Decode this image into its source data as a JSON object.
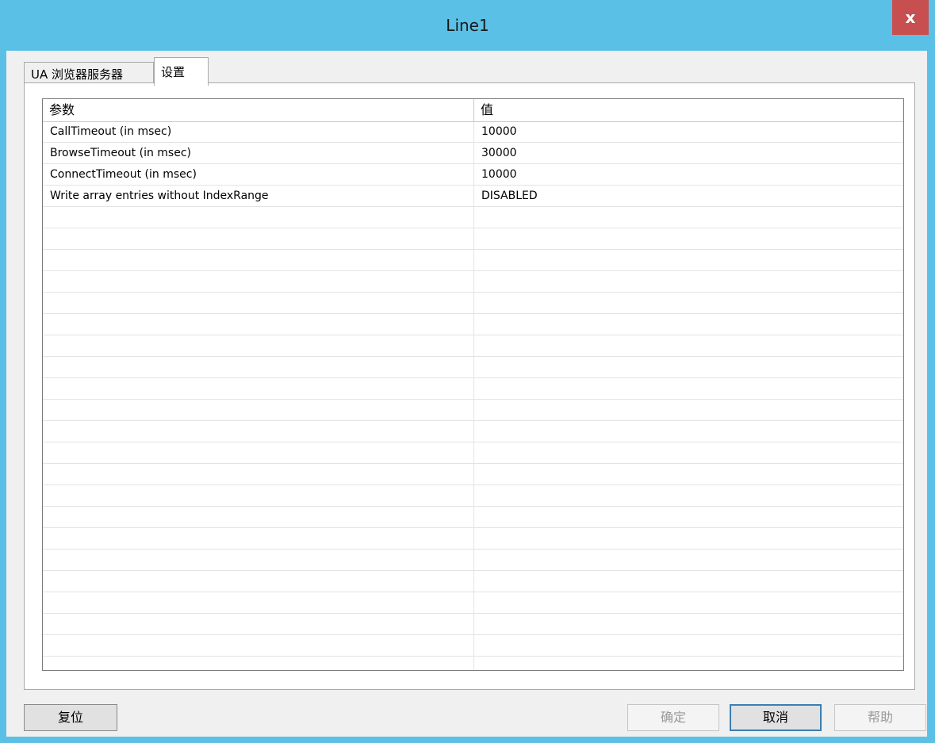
{
  "window": {
    "title": "Line1",
    "close_label": "x"
  },
  "tabs": [
    {
      "label": "UA 浏览器服务器",
      "active": false
    },
    {
      "label": "设置",
      "active": true
    }
  ],
  "grid": {
    "columns": [
      "参数",
      "值"
    ],
    "rows": [
      {
        "param": "CallTimeout (in msec)",
        "value": "10000"
      },
      {
        "param": "BrowseTimeout (in msec)",
        "value": "30000"
      },
      {
        "param": "ConnectTimeout (in msec)",
        "value": "10000"
      },
      {
        "param": "Write array entries without IndexRange",
        "value": "DISABLED"
      }
    ]
  },
  "buttons": {
    "reset": "复位",
    "ok": "确定",
    "cancel": "取消",
    "help": "帮助"
  }
}
